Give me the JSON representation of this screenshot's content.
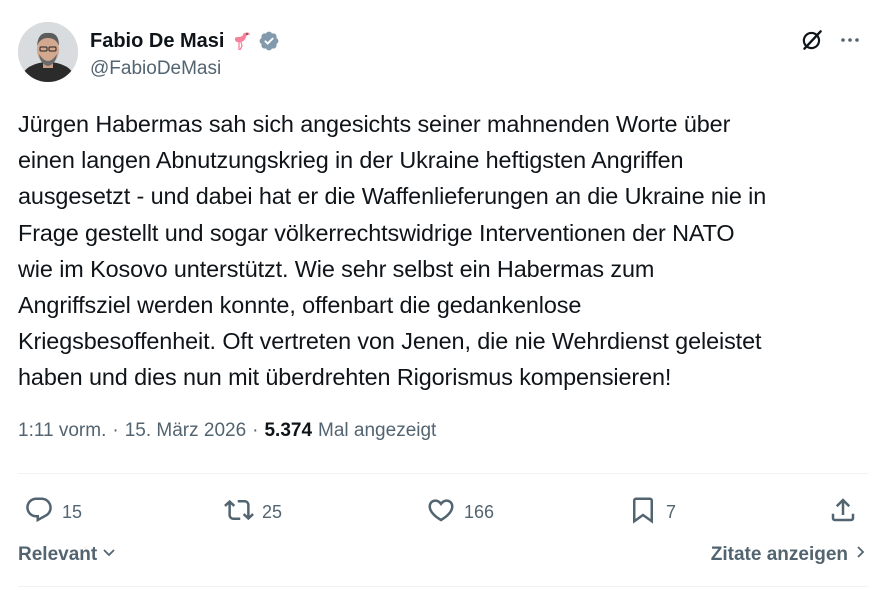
{
  "author": {
    "display_name": "Fabio De Masi",
    "handle": "@FabioDeMasi",
    "emoji": "flamingo-icon",
    "verified_icon": "verified-badge-icon",
    "verified_color": "#829aab"
  },
  "header_actions": {
    "grok_icon": "grok-icon",
    "more_icon": "more-icon"
  },
  "tweet": {
    "lines": [
      "Jürgen Habermas sah sich angesichts seiner mahnenden Worte über",
      "einen langen Abnutzungskrieg in der Ukraine heftigsten Angriffen",
      "ausgesetzt - und dabei hat er die Waffenlieferungen an die Ukraine nie in",
      "Frage gestellt und sogar völkerrechtswidrige Interventionen der NATO",
      "wie im Kosovo unterstützt. Wie sehr selbst ein Habermas zum",
      "Angriffsziel werden konnte, offenbart die gedankenlose",
      "Kriegsbesoffenheit. Oft vertreten von Jenen, die nie Wehrdienst geleistet",
      "haben und dies nun mit überdrehten Rigorismus kompensieren!"
    ]
  },
  "meta": {
    "time": "1:11 vorm.",
    "separator": "·",
    "date": "15. März 2026",
    "views_count": "5.374",
    "views_label": "Mal angezeigt"
  },
  "actions": {
    "reply": {
      "icon": "reply-icon",
      "count": "15"
    },
    "repost": {
      "icon": "repost-icon",
      "count": "25"
    },
    "like": {
      "icon": "heart-icon",
      "count": "166"
    },
    "bookmark": {
      "icon": "bookmark-icon",
      "count": "7"
    },
    "share": {
      "icon": "share-icon"
    }
  },
  "footer": {
    "sort_label": "Relevant",
    "quotes_label": "Zitate anzeigen"
  },
  "colors": {
    "text_primary": "#0f1419",
    "text_secondary": "#536471",
    "divider": "#eff3f4"
  }
}
